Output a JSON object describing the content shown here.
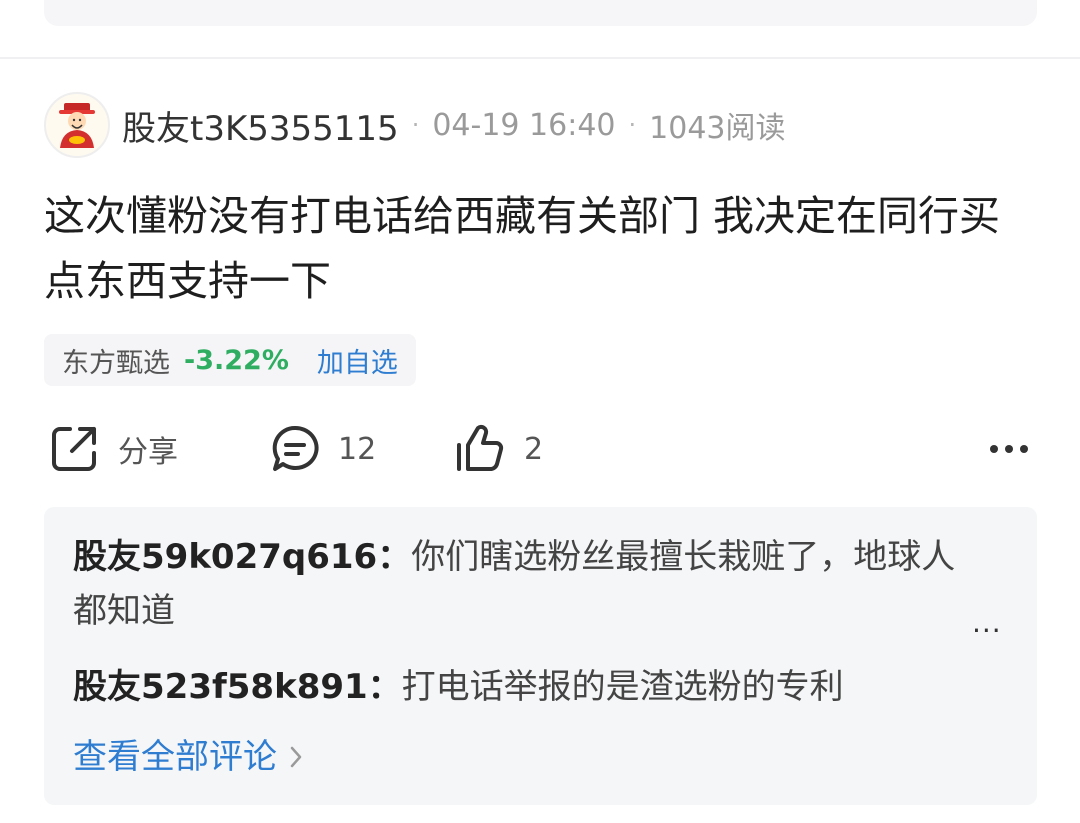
{
  "post": {
    "username": "股友t3K5355115",
    "date": "04-19 16:40",
    "reads": "1043阅读",
    "text": "这次懂粉没有打电话给西藏有关部门  我决定在同行买点东西支持一下"
  },
  "stock": {
    "name": "东方甄选",
    "change": "-3.22%",
    "add_label": "加自选"
  },
  "actions": {
    "share_label": "分享",
    "comment_count": "12",
    "like_count": "2"
  },
  "comments": [
    {
      "user": "股友59k027q616",
      "sep": "：",
      "text": "你们瞎选粉丝最擅长栽赃了，地球人都知道"
    },
    {
      "user": "股友523f58k891",
      "sep": "：",
      "text": "打电话举报的是渣选粉的专利"
    }
  ],
  "comments_more": "...",
  "view_all_label": "查看全部评论",
  "colors": {
    "link": "#2f7dd1",
    "stock_down": "#2fae62",
    "comment_bg": "#f5f6f8"
  }
}
